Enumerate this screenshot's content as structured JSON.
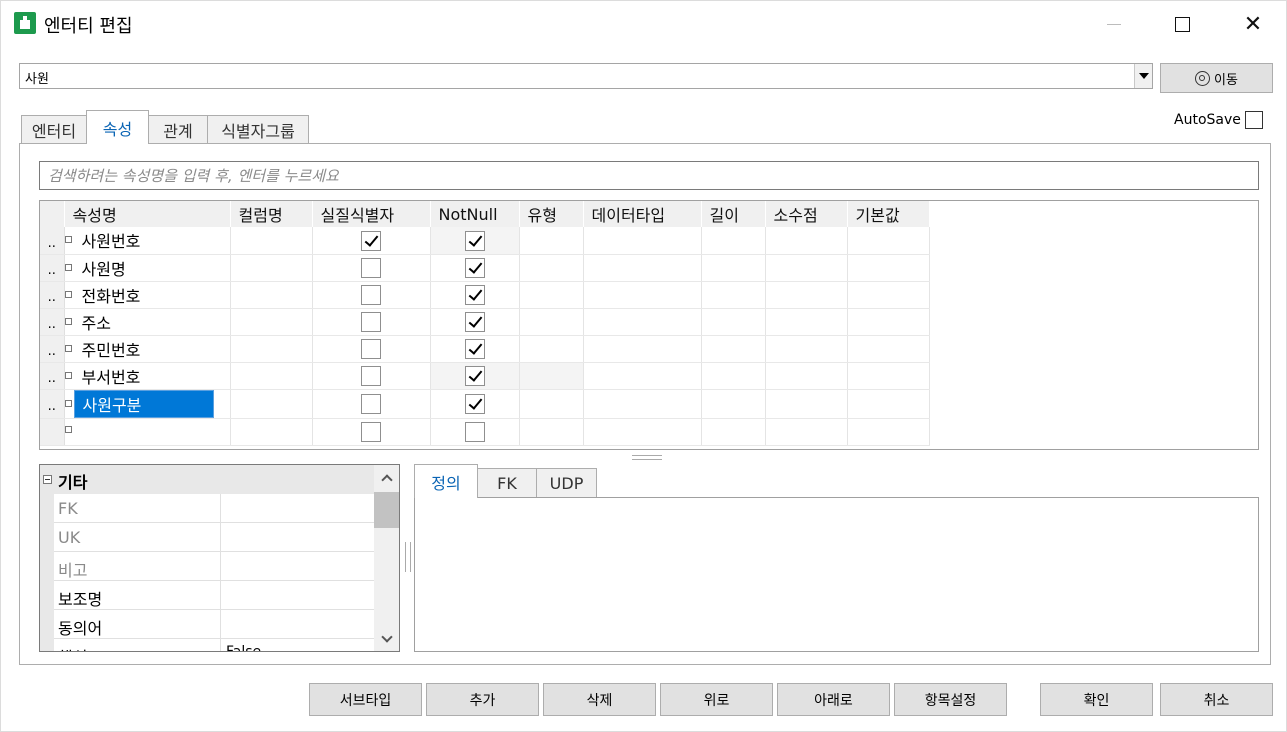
{
  "window": {
    "title": "엔터티 편집"
  },
  "entity_combo": {
    "value": "사원"
  },
  "move_button": {
    "label": "이동"
  },
  "autosave": {
    "label": "AutoSave",
    "checked": false
  },
  "tabs": [
    {
      "label": "엔터티",
      "active": false
    },
    {
      "label": "속성",
      "active": true
    },
    {
      "label": "관계",
      "active": false
    },
    {
      "label": "식별자그룹",
      "active": false
    }
  ],
  "search": {
    "placeholder": "검색하려는 속성명을 입력 후, 엔터를 누르세요"
  },
  "grid": {
    "columns": [
      "속성명",
      "컬럼명",
      "실질식별자",
      "NotNull",
      "유형",
      "데이터타입",
      "길이",
      "소수점",
      "기본값"
    ],
    "row_header": "..",
    "rows": [
      {
        "name": "사원번호",
        "real_id": true,
        "not_null": true
      },
      {
        "name": "사원명",
        "real_id": false,
        "not_null": true
      },
      {
        "name": "전화번호",
        "real_id": false,
        "not_null": true
      },
      {
        "name": "주소",
        "real_id": false,
        "not_null": true
      },
      {
        "name": "주민번호",
        "real_id": false,
        "not_null": true
      },
      {
        "name": "부서번호",
        "real_id": false,
        "not_null": true
      },
      {
        "name": "사원구분",
        "real_id": false,
        "not_null": true,
        "selected": true
      },
      {
        "name": "",
        "real_id": false,
        "not_null": false
      }
    ]
  },
  "properties": {
    "category": "기타",
    "rows": [
      {
        "key": "FK",
        "value": "",
        "dim": true
      },
      {
        "key": "UK",
        "value": "",
        "dim": true
      },
      {
        "key": "비고",
        "value": "",
        "dim": true
      },
      {
        "key": "보조명",
        "value": "",
        "dim": false
      },
      {
        "key": "동의어",
        "value": "",
        "dim": false
      },
      {
        "key": "핵심",
        "value": "False",
        "dim": false
      }
    ]
  },
  "subtabs": [
    {
      "label": "정의",
      "active": true
    },
    {
      "label": "FK",
      "active": false
    },
    {
      "label": "UDP",
      "active": false
    }
  ],
  "buttons": {
    "subtype": "서브타입",
    "add": "추가",
    "delete": "삭제",
    "up": "위로",
    "down": "아래로",
    "columns": "항목설정",
    "ok": "확인",
    "cancel": "취소"
  },
  "colors": {
    "accent": "#0078d7",
    "tab_active_text": "#0a64b4",
    "app_icon": "#1d9a4d"
  }
}
